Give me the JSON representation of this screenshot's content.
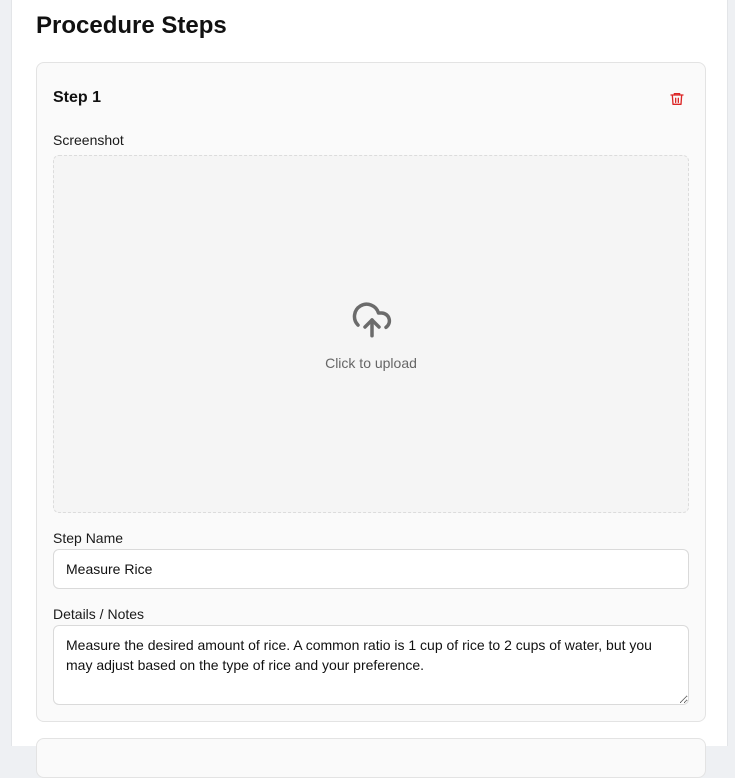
{
  "section": {
    "title": "Procedure Steps"
  },
  "steps": [
    {
      "title": "Step 1",
      "screenshot_label": "Screenshot",
      "upload_text": "Click to upload",
      "name_label": "Step Name",
      "name_value": "Measure Rice",
      "notes_label": "Details / Notes",
      "notes_value": "Measure the desired amount of rice. A common ratio is 1 cup of rice to 2 cups of water, but you may adjust based on the type of rice and your preference."
    }
  ],
  "icons": {
    "delete": "trash-icon",
    "upload": "cloud-upload-icon"
  },
  "colors": {
    "delete_icon": "#dc2626",
    "upload_icon": "#6b6b6b"
  }
}
